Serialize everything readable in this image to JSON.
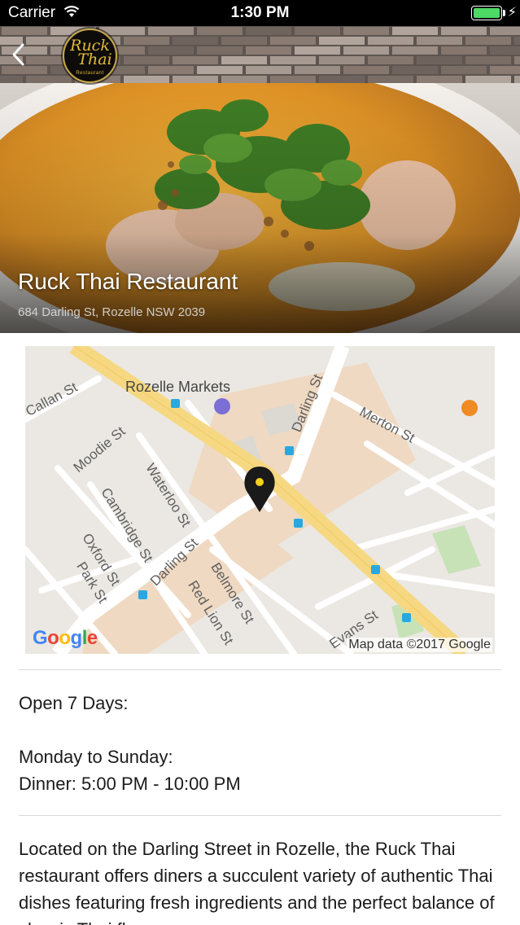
{
  "status_bar": {
    "carrier": "Carrier",
    "time": "1:30 PM",
    "battery_level": 1.0,
    "icons": [
      "wifi-icon",
      "battery-icon",
      "charging-bolt-icon"
    ]
  },
  "header": {
    "back_icon": "chevron-left-icon",
    "logo": {
      "line1": "Ruck",
      "line2": "Thai",
      "line3": "Restaurant"
    }
  },
  "restaurant": {
    "name": "Ruck Thai Restaurant",
    "address": "684 Darling St, Rozelle NSW 2039"
  },
  "map": {
    "streets": [
      "Callan St",
      "Darling St",
      "Merton St",
      "Moodie St",
      "Waterloo St",
      "Cambridge St",
      "Darling St",
      "Oxford St",
      "Park St",
      "Belmore St",
      "Red Lion St",
      "Evans St"
    ],
    "poi": "Rozelle Markets",
    "attribution": "Map data ©2017 Google",
    "google_logo": [
      "G",
      "o",
      "o",
      "g",
      "l",
      "e"
    ],
    "colors": {
      "google_blue": "#4285F4",
      "google_red": "#EA4335",
      "google_yellow": "#FBBC05",
      "google_green": "#34A853",
      "main_road": "#f6d882",
      "pin": "#1a1a1a",
      "pin_dot": "#f4d21b"
    }
  },
  "hours": {
    "line1": "Open 7 Days:",
    "line2": "Monday to Sunday:",
    "line3": "Dinner: 5:00 PM - 10:00 PM"
  },
  "description": "Located on the Darling Street in Rozelle, the Ruck Thai restaurant offers diners a succulent variety of authentic Thai dishes featuring fresh ingredients and the perfect balance of classic Thai flavours."
}
